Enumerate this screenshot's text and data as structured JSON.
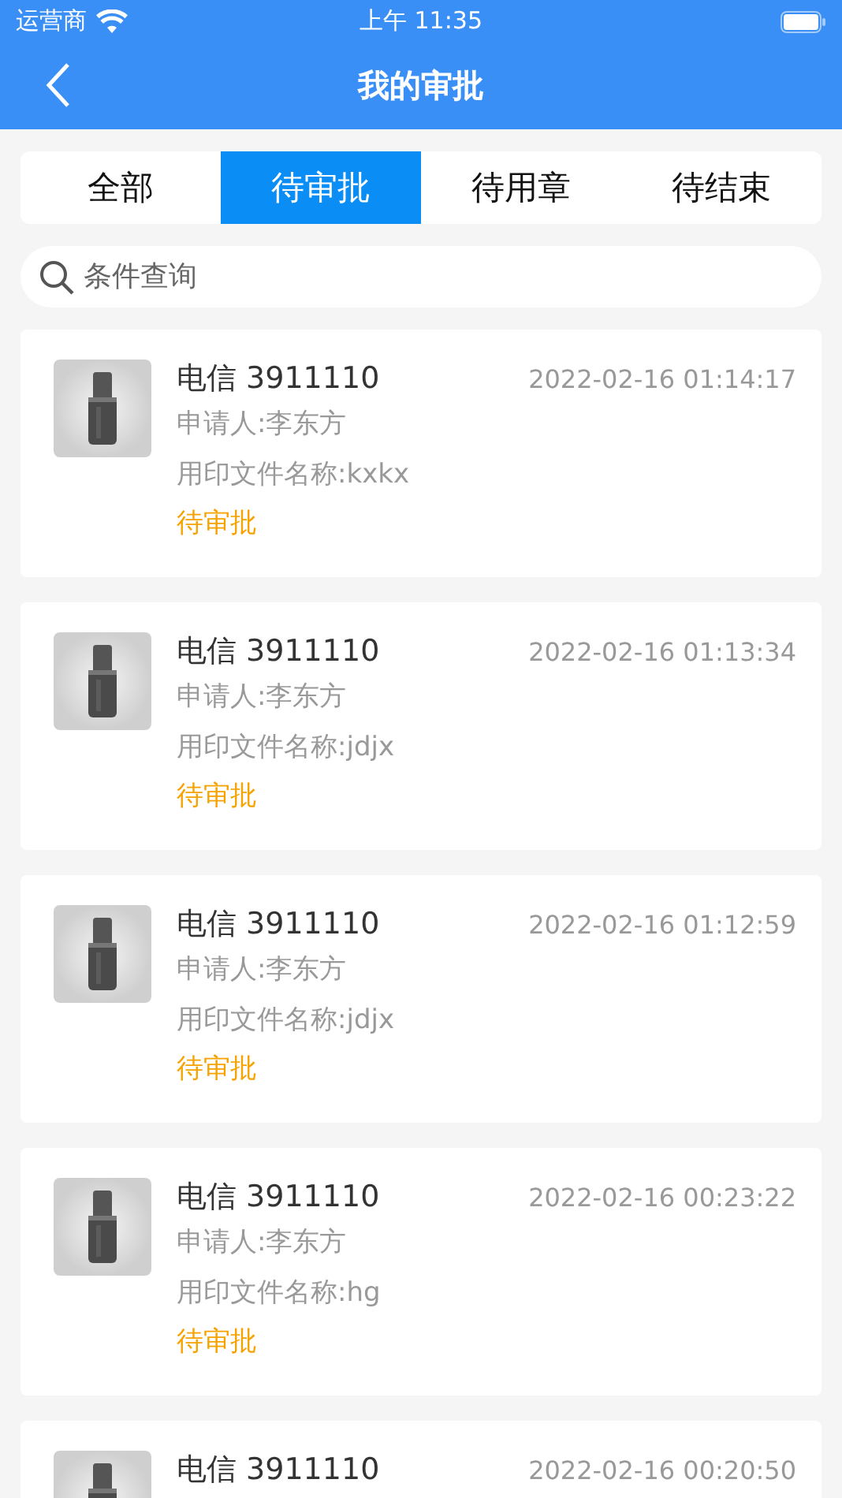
{
  "status_bar": {
    "carrier": "运营商",
    "time": "上午 11:35"
  },
  "nav": {
    "title": "我的审批"
  },
  "tabs": [
    {
      "label": "全部",
      "selected": false
    },
    {
      "label": "待审批",
      "selected": true
    },
    {
      "label": "待用章",
      "selected": false
    },
    {
      "label": "待结束",
      "selected": false
    }
  ],
  "search": {
    "placeholder": "条件查询"
  },
  "items": [
    {
      "title": "电信 3911110",
      "time": "2022-02-16 01:14:17",
      "applicant": "申请人:李东方",
      "file": "用印文件名称:kxkx",
      "status": "待审批"
    },
    {
      "title": "电信 3911110",
      "time": "2022-02-16 01:13:34",
      "applicant": "申请人:李东方",
      "file": "用印文件名称:jdjx",
      "status": "待审批"
    },
    {
      "title": "电信 3911110",
      "time": "2022-02-16 01:12:59",
      "applicant": "申请人:李东方",
      "file": "用印文件名称:jdjx",
      "status": "待审批"
    },
    {
      "title": "电信 3911110",
      "time": "2022-02-16 00:23:22",
      "applicant": "申请人:李东方",
      "file": "用印文件名称:hg",
      "status": "待审批"
    },
    {
      "title": "电信 3911110",
      "time": "2022-02-16 00:20:50"
    }
  ]
}
